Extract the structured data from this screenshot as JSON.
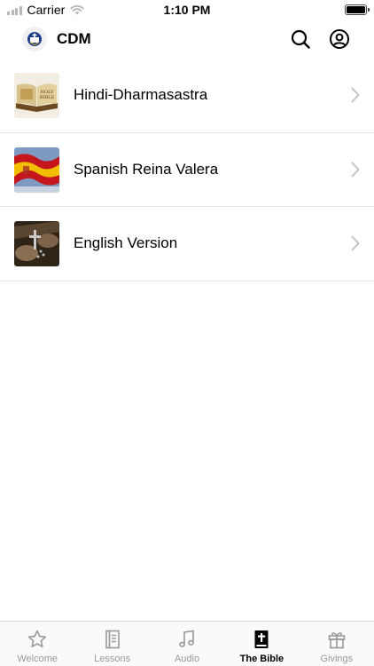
{
  "status_bar": {
    "carrier": "Carrier",
    "time": "1:10 PM"
  },
  "header": {
    "title": "CDM"
  },
  "bibles": [
    {
      "label": "Hindi-Dharmasastra",
      "thumb": "holy-bible-book"
    },
    {
      "label": "Spanish Reina Valera",
      "thumb": "spain-flag"
    },
    {
      "label": "English Version",
      "thumb": "rosary-hands"
    }
  ],
  "tabs": [
    {
      "label": "Welcome",
      "icon": "star-icon",
      "active": false
    },
    {
      "label": "Lessons",
      "icon": "book-lessons-icon",
      "active": false
    },
    {
      "label": "Audio",
      "icon": "music-note-icon",
      "active": false
    },
    {
      "label": "The Bible",
      "icon": "bible-cross-icon",
      "active": true
    },
    {
      "label": "Givings",
      "icon": "gift-icon",
      "active": false
    }
  ],
  "colors": {
    "active": "#000000",
    "inactive": "#999999",
    "divider": "#e3e3e3"
  }
}
